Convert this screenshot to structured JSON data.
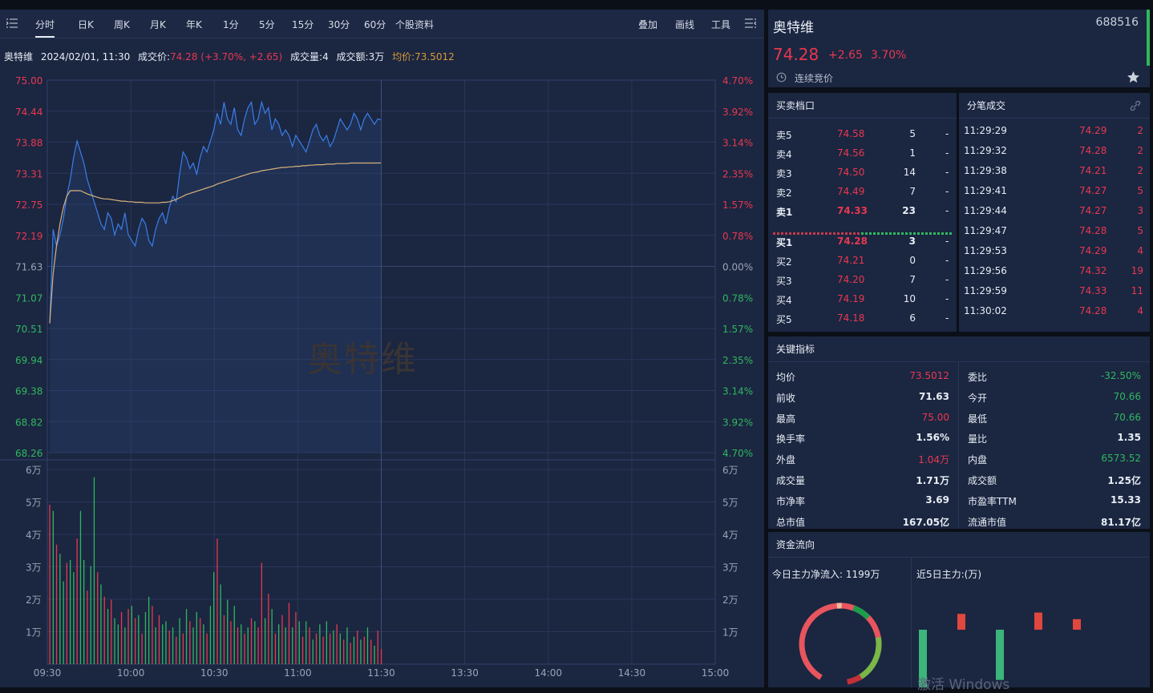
{
  "toolbar": {
    "menu_icon": "list-menu-icon",
    "tabs": [
      "分时",
      "日K",
      "周K",
      "月K",
      "年K",
      "1分",
      "5分",
      "15分",
      "30分",
      "60分",
      "个股资料"
    ],
    "right": [
      "叠加",
      "画线",
      "工具"
    ],
    "right_icon": "list-menu-icon"
  },
  "info": {
    "name": "奥特维",
    "datetime": "2024/02/01, 11:30",
    "price_label": "成交价:",
    "price_value": "74.28 (+3.70%, +2.65)",
    "vol_label": "成交量:",
    "vol_value": "4",
    "amt_label": "成交额:",
    "amt_value": "3万",
    "avg_label": "均价:",
    "avg_value": "73.5012"
  },
  "watermark": "奥特维",
  "windows_watermark": "激活 Windows",
  "colors": {
    "up": "#e8384f",
    "down": "#2fb85f",
    "price_line": "#3a7ee8",
    "avg_line": "#d8b27a",
    "bg": "#1b2641"
  },
  "chart_data": {
    "type": "line",
    "y_left_ticks": [
      "75.00",
      "74.44",
      "73.88",
      "73.31",
      "72.75",
      "72.19",
      "71.63",
      "71.07",
      "70.51",
      "69.94",
      "69.38",
      "68.82",
      "68.26"
    ],
    "y_right_ticks": [
      "4.70%",
      "3.92%",
      "3.14%",
      "2.35%",
      "1.57%",
      "0.78%",
      "0.00%",
      "0.78%",
      "1.57%",
      "2.35%",
      "3.14%",
      "3.92%",
      "4.70%"
    ],
    "vol_ticks": [
      "6万",
      "5万",
      "4万",
      "3万",
      "2万",
      "1万"
    ],
    "x_ticks": [
      "09:30",
      "10:00",
      "10:30",
      "11:00",
      "11:30",
      "13:30",
      "14:00",
      "14:30",
      "15:00"
    ],
    "ylim": [
      68.26,
      75.0
    ],
    "prev_close": 71.63,
    "session_minutes": 240,
    "price": [
      70.6,
      72.3,
      72.0,
      72.2,
      72.5,
      72.9,
      73.2,
      73.6,
      73.9,
      73.7,
      73.5,
      73.2,
      73.0,
      72.8,
      72.6,
      72.4,
      72.3,
      72.6,
      72.5,
      72.2,
      72.4,
      72.3,
      72.6,
      72.2,
      72.1,
      72.0,
      72.3,
      72.5,
      72.4,
      72.1,
      72.0,
      72.3,
      72.5,
      72.6,
      72.4,
      72.7,
      72.9,
      72.8,
      73.3,
      73.7,
      73.6,
      73.4,
      73.5,
      73.3,
      73.6,
      73.8,
      73.7,
      73.9,
      74.1,
      74.4,
      74.2,
      74.6,
      74.3,
      74.2,
      74.5,
      74.1,
      74.0,
      74.3,
      74.5,
      74.6,
      74.2,
      74.3,
      74.6,
      74.4,
      74.5,
      74.1,
      74.3,
      74.2,
      74.0,
      74.1,
      74.0,
      73.8,
      74.0,
      73.9,
      73.8,
      73.7,
      73.9,
      74.1,
      74.2,
      74.0,
      73.9,
      74.0,
      73.8,
      73.9,
      74.1,
      74.3,
      74.2,
      74.1,
      74.2,
      74.4,
      74.3,
      74.1,
      74.3,
      74.4,
      74.3,
      74.2,
      74.3,
      74.28
    ],
    "avg": [
      70.6,
      71.5,
      72.0,
      72.4,
      72.7,
      72.9,
      73.0,
      73.0,
      73.0,
      73.0,
      72.97,
      72.94,
      72.92,
      72.9,
      72.88,
      72.86,
      72.85,
      72.85,
      72.84,
      72.83,
      72.82,
      72.81,
      72.81,
      72.8,
      72.8,
      72.79,
      72.79,
      72.79,
      72.78,
      72.78,
      72.78,
      72.78,
      72.78,
      72.79,
      72.79,
      72.8,
      72.82,
      72.84,
      72.87,
      72.9,
      72.93,
      72.95,
      72.97,
      72.99,
      73.01,
      73.03,
      73.05,
      73.07,
      73.09,
      73.12,
      73.14,
      73.16,
      73.18,
      73.2,
      73.22,
      73.24,
      73.26,
      73.28,
      73.3,
      73.32,
      73.33,
      73.34,
      73.36,
      73.37,
      73.38,
      73.39,
      73.4,
      73.41,
      73.42,
      73.42,
      73.43,
      73.43,
      73.44,
      73.44,
      73.45,
      73.45,
      73.46,
      73.46,
      73.47,
      73.47,
      73.47,
      73.48,
      73.48,
      73.48,
      73.49,
      73.49,
      73.49,
      73.49,
      73.5,
      73.5,
      73.5,
      73.5,
      73.5,
      73.5,
      73.5,
      73.5,
      73.5,
      73.5012
    ],
    "volume": [
      5.2,
      5.0,
      3.9,
      3.6,
      2.7,
      3.3,
      3.4,
      3.0,
      4.1,
      5.0,
      3.4,
      2.4,
      3.2,
      6.1,
      3.0,
      2.6,
      2.2,
      1.8,
      2.1,
      1.5,
      1.3,
      1.7,
      1.2,
      1.8,
      1.9,
      1.5,
      1.6,
      1.0,
      1.7,
      2.2,
      1.9,
      1.2,
      1.6,
      1.3,
      1.4,
      1.1,
      1.2,
      0.9,
      1.5,
      1.0,
      1.8,
      1.4,
      1.2,
      1.7,
      1.5,
      1.3,
      1.0,
      1.9,
      3.0,
      4.1,
      2.6,
      1.6,
      2.1,
      1.4,
      1.9,
      1.2,
      1.3,
      1.0,
      1.2,
      1.5,
      1.4,
      1.2,
      3.3,
      1.5,
      2.3,
      1.8,
      1.0,
      1.3,
      1.6,
      1.2,
      2.0,
      1.2,
      1.7,
      1.4,
      0.9,
      1.4,
      1.2,
      0.8,
      1.0,
      1.3,
      0.9,
      1.4,
      1.0,
      1.1,
      1.3,
      1.0,
      0.8,
      1.2,
      0.7,
      0.9,
      1.1,
      0.8,
      0.9,
      1.2,
      0.8,
      0.6,
      1.1,
      0.5
    ],
    "volume_up": [
      1,
      0,
      1,
      0,
      0,
      1,
      0,
      0,
      1,
      0,
      0,
      1,
      0,
      0,
      1,
      0,
      1,
      0,
      1,
      0,
      0,
      1,
      0,
      1,
      0,
      1,
      0,
      1,
      0,
      0,
      1,
      0,
      1,
      0,
      0,
      1,
      0,
      1,
      0,
      1,
      0,
      1,
      0,
      0,
      1,
      0,
      1,
      0,
      0,
      1,
      0,
      1,
      0,
      1,
      0,
      1,
      0,
      1,
      0,
      1,
      0,
      1,
      1,
      0,
      1,
      0,
      1,
      0,
      1,
      0,
      1,
      0,
      1,
      0,
      1,
      0,
      1,
      0,
      1,
      0,
      1,
      0,
      1,
      0,
      1,
      0,
      1,
      0,
      1,
      0,
      1,
      0,
      1,
      0,
      1,
      0,
      1,
      1
    ]
  },
  "quote": {
    "name": "奥特维",
    "code": "688516",
    "price": "74.28",
    "change": "+2.65",
    "pct": "3.70%",
    "status": "连续竞价",
    "clock_icon": "clock-icon",
    "star_icon": "star-icon"
  },
  "orderbook": {
    "title": "买卖档口",
    "sell": [
      {
        "label": "卖5",
        "price": "74.58",
        "vol": "5",
        "ex": "-"
      },
      {
        "label": "卖4",
        "price": "74.56",
        "vol": "1",
        "ex": "-"
      },
      {
        "label": "卖3",
        "price": "74.50",
        "vol": "14",
        "ex": "-"
      },
      {
        "label": "卖2",
        "price": "74.49",
        "vol": "7",
        "ex": "-"
      },
      {
        "label": "卖1",
        "price": "74.33",
        "vol": "23",
        "ex": "-"
      }
    ],
    "buy": [
      {
        "label": "买1",
        "price": "74.28",
        "vol": "3",
        "ex": "-"
      },
      {
        "label": "买2",
        "price": "74.21",
        "vol": "0",
        "ex": "-"
      },
      {
        "label": "买3",
        "price": "74.20",
        "vol": "7",
        "ex": "-"
      },
      {
        "label": "买4",
        "price": "74.19",
        "vol": "10",
        "ex": "-"
      },
      {
        "label": "买5",
        "price": "74.18",
        "vol": "6",
        "ex": "-"
      }
    ]
  },
  "trades": {
    "title": "分笔成交",
    "link_icon": "link-icon",
    "rows": [
      {
        "time": "11:29:29",
        "price": "74.29",
        "vol": "2"
      },
      {
        "time": "11:29:32",
        "price": "74.28",
        "vol": "2"
      },
      {
        "time": "11:29:38",
        "price": "74.21",
        "vol": "2"
      },
      {
        "time": "11:29:41",
        "price": "74.27",
        "vol": "5"
      },
      {
        "time": "11:29:44",
        "price": "74.27",
        "vol": "3"
      },
      {
        "time": "11:29:47",
        "price": "74.28",
        "vol": "5"
      },
      {
        "time": "11:29:53",
        "price": "74.29",
        "vol": "4"
      },
      {
        "time": "11:29:56",
        "price": "74.32",
        "vol": "19"
      },
      {
        "time": "11:29:59",
        "price": "74.33",
        "vol": "11"
      },
      {
        "time": "11:30:02",
        "price": "74.28",
        "vol": "4"
      }
    ]
  },
  "indicators": {
    "title": "关键指标",
    "left": [
      {
        "k": "均价",
        "v": "73.5012",
        "c": "red"
      },
      {
        "k": "前收",
        "v": "71.63",
        "c": "white"
      },
      {
        "k": "最高",
        "v": "75.00",
        "c": "red"
      },
      {
        "k": "换手率",
        "v": "1.56%",
        "c": "white"
      },
      {
        "k": "外盘",
        "v": "1.04万",
        "c": "red"
      },
      {
        "k": "成交量",
        "v": "1.71万",
        "c": "white"
      },
      {
        "k": "市净率",
        "v": "3.69",
        "c": "white"
      },
      {
        "k": "总市值",
        "v": "167.05亿",
        "c": "white"
      }
    ],
    "right": [
      {
        "k": "委比",
        "v": "-32.50%",
        "c": "green"
      },
      {
        "k": "今开",
        "v": "70.66",
        "c": "green"
      },
      {
        "k": "最低",
        "v": "70.66",
        "c": "green"
      },
      {
        "k": "量比",
        "v": "1.35",
        "c": "white"
      },
      {
        "k": "内盘",
        "v": "6573.52",
        "c": "green"
      },
      {
        "k": "成交额",
        "v": "1.25亿",
        "c": "white"
      },
      {
        "k": "市盈率TTM",
        "v": "15.33",
        "c": "white"
      },
      {
        "k": "流通市值",
        "v": "81.17亿",
        "c": "white"
      }
    ]
  },
  "fund": {
    "title": "资金流向",
    "today_label": "今日主力净流入: 1199万",
    "five_label": "近5日主力:(万)",
    "five_day": [
      -220,
      60,
      -190,
      65,
      40
    ]
  }
}
